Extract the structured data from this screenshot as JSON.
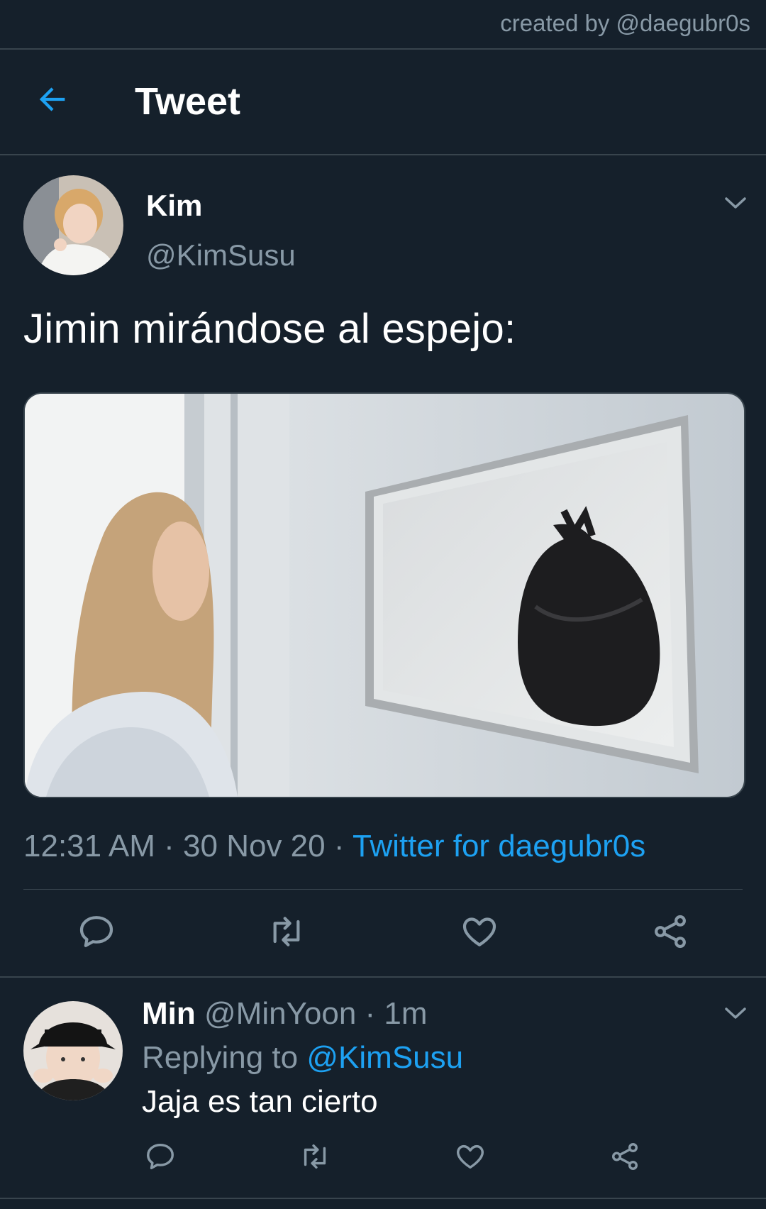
{
  "watermark": "created by @daegubr0s",
  "header": {
    "title": "Tweet",
    "back_icon": "back-arrow-icon"
  },
  "tweet": {
    "name": "Kim",
    "handle": "@KimSusu",
    "text": "Jimin mirándose al espejo:",
    "time": "12:31 AM",
    "date": "30 Nov 20",
    "source": "Twitter for daegubr0s",
    "separator": "·",
    "actions": [
      "reply-icon",
      "retweet-icon",
      "like-icon",
      "share-icon"
    ]
  },
  "reply": {
    "name": "Min",
    "handle": "@MinYoon",
    "age": "1m",
    "separator": "·",
    "replying_prefix": "Replying to",
    "replying_to": "@KimSusu",
    "text": "Jaja es tan cierto",
    "actions": [
      "reply-icon",
      "retweet-icon",
      "like-icon",
      "share-icon"
    ]
  },
  "colors": {
    "background": "#15202b",
    "accent": "#1da1f2",
    "muted": "#8899a6",
    "divider": "#38444d"
  }
}
